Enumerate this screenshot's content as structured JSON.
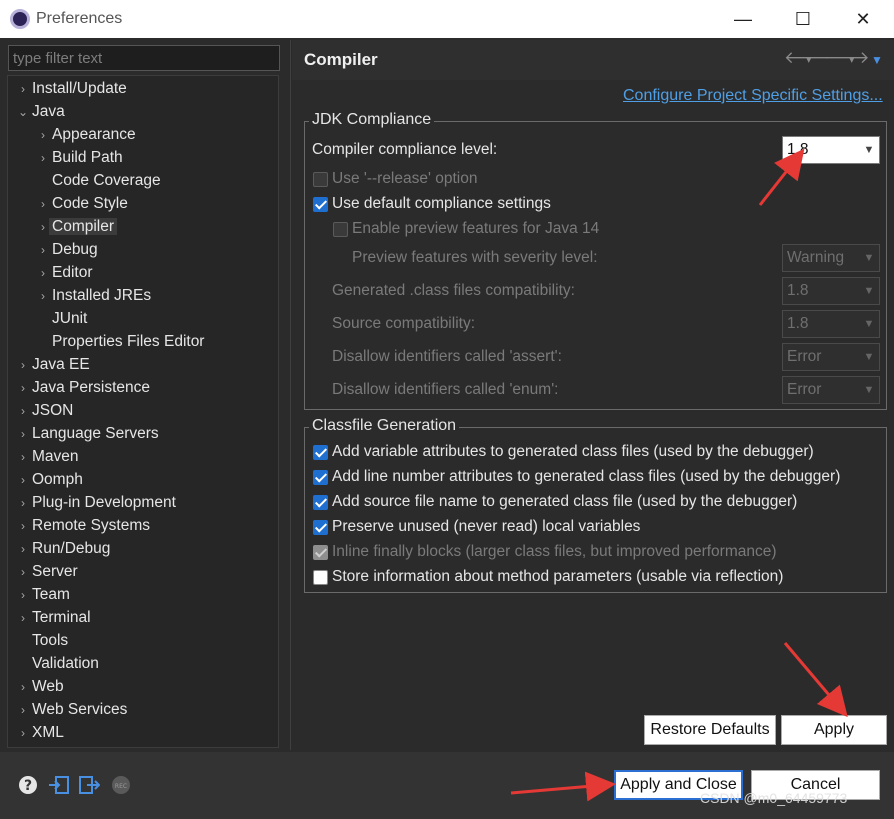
{
  "window": {
    "title": "Preferences",
    "minimize": "—",
    "maximize": "☐",
    "close": "✕"
  },
  "sidebar": {
    "filter_placeholder": "type filter text",
    "tree": [
      {
        "label": "Install/Update",
        "arrow": "›",
        "level": 0
      },
      {
        "label": "Java",
        "arrow": "⌄",
        "level": 0
      },
      {
        "label": "Appearance",
        "arrow": "›",
        "level": 1
      },
      {
        "label": "Build Path",
        "arrow": "›",
        "level": 1
      },
      {
        "label": "Code Coverage",
        "arrow": "",
        "level": 1
      },
      {
        "label": "Code Style",
        "arrow": "›",
        "level": 1
      },
      {
        "label": "Compiler",
        "arrow": "›",
        "level": 1,
        "selected": true
      },
      {
        "label": "Debug",
        "arrow": "›",
        "level": 1
      },
      {
        "label": "Editor",
        "arrow": "›",
        "level": 1
      },
      {
        "label": "Installed JREs",
        "arrow": "›",
        "level": 1
      },
      {
        "label": "JUnit",
        "arrow": "",
        "level": 1
      },
      {
        "label": "Properties Files Editor",
        "arrow": "",
        "level": 1
      },
      {
        "label": "Java EE",
        "arrow": "›",
        "level": 0
      },
      {
        "label": "Java Persistence",
        "arrow": "›",
        "level": 0
      },
      {
        "label": "JSON",
        "arrow": "›",
        "level": 0
      },
      {
        "label": "Language Servers",
        "arrow": "›",
        "level": 0
      },
      {
        "label": "Maven",
        "arrow": "›",
        "level": 0
      },
      {
        "label": "Oomph",
        "arrow": "›",
        "level": 0
      },
      {
        "label": "Plug-in Development",
        "arrow": "›",
        "level": 0
      },
      {
        "label": "Remote Systems",
        "arrow": "›",
        "level": 0
      },
      {
        "label": "Run/Debug",
        "arrow": "›",
        "level": 0
      },
      {
        "label": "Server",
        "arrow": "›",
        "level": 0
      },
      {
        "label": "Team",
        "arrow": "›",
        "level": 0
      },
      {
        "label": "Terminal",
        "arrow": "›",
        "level": 0
      },
      {
        "label": "Tools",
        "arrow": "",
        "level": 0
      },
      {
        "label": "Validation",
        "arrow": "",
        "level": 0
      },
      {
        "label": "Web",
        "arrow": "›",
        "level": 0
      },
      {
        "label": "Web Services",
        "arrow": "›",
        "level": 0
      },
      {
        "label": "XML",
        "arrow": "›",
        "level": 0
      }
    ]
  },
  "page": {
    "title": "Compiler",
    "nav": {
      "back": "🡐",
      "forward": "🡒",
      "dropdown": "▾",
      "menu": "▼"
    },
    "link": "Configure Project Specific Settings...",
    "jdk": {
      "group_label": "JDK Compliance",
      "compliance_label": "Compiler compliance level:",
      "compliance_value": "1.8",
      "release_label": "Use '--release' option",
      "default_label": "Use default compliance settings",
      "preview_label": "Enable preview features for Java 14",
      "severity_label": "Preview features with severity level:",
      "severity_value": "Warning",
      "generated_label": "Generated .class files compatibility:",
      "generated_value": "1.8",
      "source_label": "Source compatibility:",
      "source_value": "1.8",
      "assert_label": "Disallow identifiers called 'assert':",
      "assert_value": "Error",
      "enum_label": "Disallow identifiers called 'enum':",
      "enum_value": "Error"
    },
    "classfile": {
      "group_label": "Classfile Generation",
      "items": [
        "Add variable attributes to generated class files (used by the debugger)",
        "Add line number attributes to generated class files (used by the debugger)",
        "Add source file name to generated class file (used by the debugger)",
        "Preserve unused (never read) local variables",
        "Inline finally blocks (larger class files, but improved performance)",
        "Store information about method parameters (usable via reflection)"
      ]
    },
    "restore_label": "Restore Defaults",
    "apply_label": "Apply"
  },
  "footer": {
    "apply_close_label": "Apply and Close",
    "cancel_label": "Cancel",
    "icons": [
      "help-icon",
      "import-icon",
      "export-icon",
      "record-icon"
    ],
    "watermark": "CSDN @m0_64459773"
  },
  "colors": {
    "accent": "#1f6fd1",
    "link": "#4f9fe6",
    "annotation_arrow": "#e53935"
  }
}
